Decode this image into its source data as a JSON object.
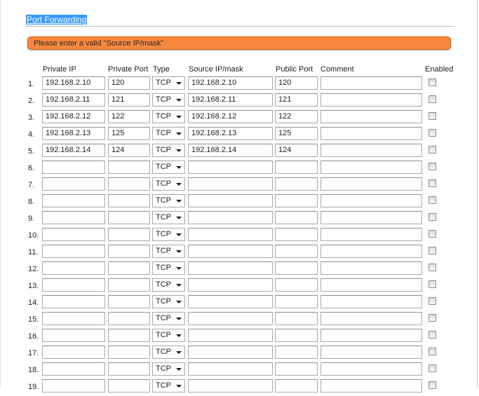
{
  "title": "Port Forwarding",
  "alert": "Please enter a valid \"Source IP/mask\"",
  "columns": {
    "private_ip": "Private IP",
    "private_port": "Private Port",
    "type": "Type",
    "source_ip": "Source IP/mask",
    "public_port": "Public Port",
    "comment": "Comment",
    "enabled": "Enabled"
  },
  "rows": [
    {
      "num": "1.",
      "private_ip": "192.168.2.10",
      "private_port": "120",
      "type": "TCP",
      "source_ip": "192.168.2.10",
      "public_port": "120",
      "comment": "",
      "enabled": false
    },
    {
      "num": "2.",
      "private_ip": "192.168.2.11",
      "private_port": "121",
      "type": "TCP",
      "source_ip": "192.168.2.11",
      "public_port": "121",
      "comment": "",
      "enabled": false
    },
    {
      "num": "3.",
      "private_ip": "192.168.2.12",
      "private_port": "122",
      "type": "TCP",
      "source_ip": "192.168.2.12",
      "public_port": "122",
      "comment": "",
      "enabled": false
    },
    {
      "num": "4.",
      "private_ip": "192.168.2.13",
      "private_port": "125",
      "type": "TCP",
      "source_ip": "192.168.2.13",
      "public_port": "125",
      "comment": "",
      "enabled": false
    },
    {
      "num": "5.",
      "private_ip": "192.168.2.14",
      "private_port": "124",
      "type": "TCP",
      "source_ip": "192.168.2.14",
      "public_port": "124",
      "comment": "",
      "enabled": false
    },
    {
      "num": "6.",
      "private_ip": "",
      "private_port": "",
      "type": "TCP",
      "source_ip": "",
      "public_port": "",
      "comment": "",
      "enabled": false
    },
    {
      "num": "7.",
      "private_ip": "",
      "private_port": "",
      "type": "TCP",
      "source_ip": "",
      "public_port": "",
      "comment": "",
      "enabled": false
    },
    {
      "num": "8.",
      "private_ip": "",
      "private_port": "",
      "type": "TCP",
      "source_ip": "",
      "public_port": "",
      "comment": "",
      "enabled": false
    },
    {
      "num": "9.",
      "private_ip": "",
      "private_port": "",
      "type": "TCP",
      "source_ip": "",
      "public_port": "",
      "comment": "",
      "enabled": false
    },
    {
      "num": "10.",
      "private_ip": "",
      "private_port": "",
      "type": "TCP",
      "source_ip": "",
      "public_port": "",
      "comment": "",
      "enabled": false
    },
    {
      "num": "11.",
      "private_ip": "",
      "private_port": "",
      "type": "TCP",
      "source_ip": "",
      "public_port": "",
      "comment": "",
      "enabled": false
    },
    {
      "num": "12.",
      "private_ip": "",
      "private_port": "",
      "type": "TCP",
      "source_ip": "",
      "public_port": "",
      "comment": "",
      "enabled": false
    },
    {
      "num": "13.",
      "private_ip": "",
      "private_port": "",
      "type": "TCP",
      "source_ip": "",
      "public_port": "",
      "comment": "",
      "enabled": false
    },
    {
      "num": "14.",
      "private_ip": "",
      "private_port": "",
      "type": "TCP",
      "source_ip": "",
      "public_port": "",
      "comment": "",
      "enabled": false
    },
    {
      "num": "15.",
      "private_ip": "",
      "private_port": "",
      "type": "TCP",
      "source_ip": "",
      "public_port": "",
      "comment": "",
      "enabled": false
    },
    {
      "num": "16.",
      "private_ip": "",
      "private_port": "",
      "type": "TCP",
      "source_ip": "",
      "public_port": "",
      "comment": "",
      "enabled": false
    },
    {
      "num": "17.",
      "private_ip": "",
      "private_port": "",
      "type": "TCP",
      "source_ip": "",
      "public_port": "",
      "comment": "",
      "enabled": false
    },
    {
      "num": "18.",
      "private_ip": "",
      "private_port": "",
      "type": "TCP",
      "source_ip": "",
      "public_port": "",
      "comment": "",
      "enabled": false
    },
    {
      "num": "19.",
      "private_ip": "",
      "private_port": "",
      "type": "TCP",
      "source_ip": "",
      "public_port": "",
      "comment": "",
      "enabled": false
    }
  ]
}
